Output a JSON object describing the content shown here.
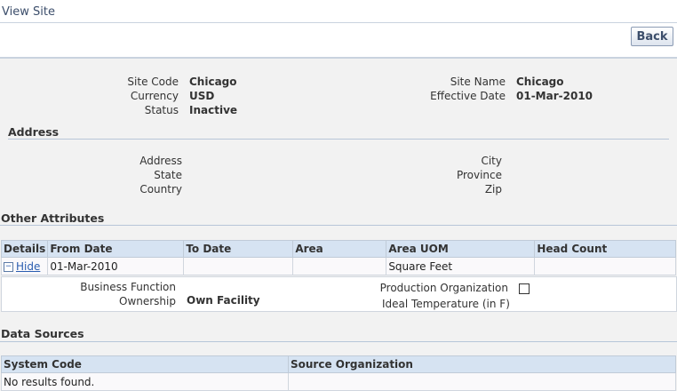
{
  "page": {
    "title": "View Site",
    "back_label": "Back"
  },
  "site": {
    "site_code_label": "Site Code",
    "site_code": "Chicago",
    "currency_label": "Currency",
    "currency": "USD",
    "status_label": "Status",
    "status": "Inactive",
    "site_name_label": "Site Name",
    "site_name": "Chicago",
    "effective_date_label": "Effective Date",
    "effective_date": "01-Mar-2010"
  },
  "address": {
    "title": "Address",
    "address_label": "Address",
    "state_label": "State",
    "country_label": "Country",
    "city_label": "City",
    "province_label": "Province",
    "zip_label": "Zip"
  },
  "other_attributes": {
    "title": "Other Attributes",
    "columns": [
      "Details",
      "From Date",
      "To Date",
      "Area",
      "Area UOM",
      "Head Count"
    ],
    "row": {
      "details_link": "Hide",
      "from_date": "01-Mar-2010",
      "to_date": "",
      "area": "",
      "area_uom": "Square Feet",
      "head_count": ""
    },
    "detail": {
      "business_function_label": "Business Function",
      "business_function": "",
      "ownership_label": "Ownership",
      "ownership": "Own Facility",
      "production_org_label": "Production Organization",
      "ideal_temp_label": "Ideal Temperature (in F)"
    }
  },
  "data_sources": {
    "title": "Data Sources",
    "columns": [
      "System Code",
      "Source Organization"
    ],
    "empty_message": "No results found."
  }
}
